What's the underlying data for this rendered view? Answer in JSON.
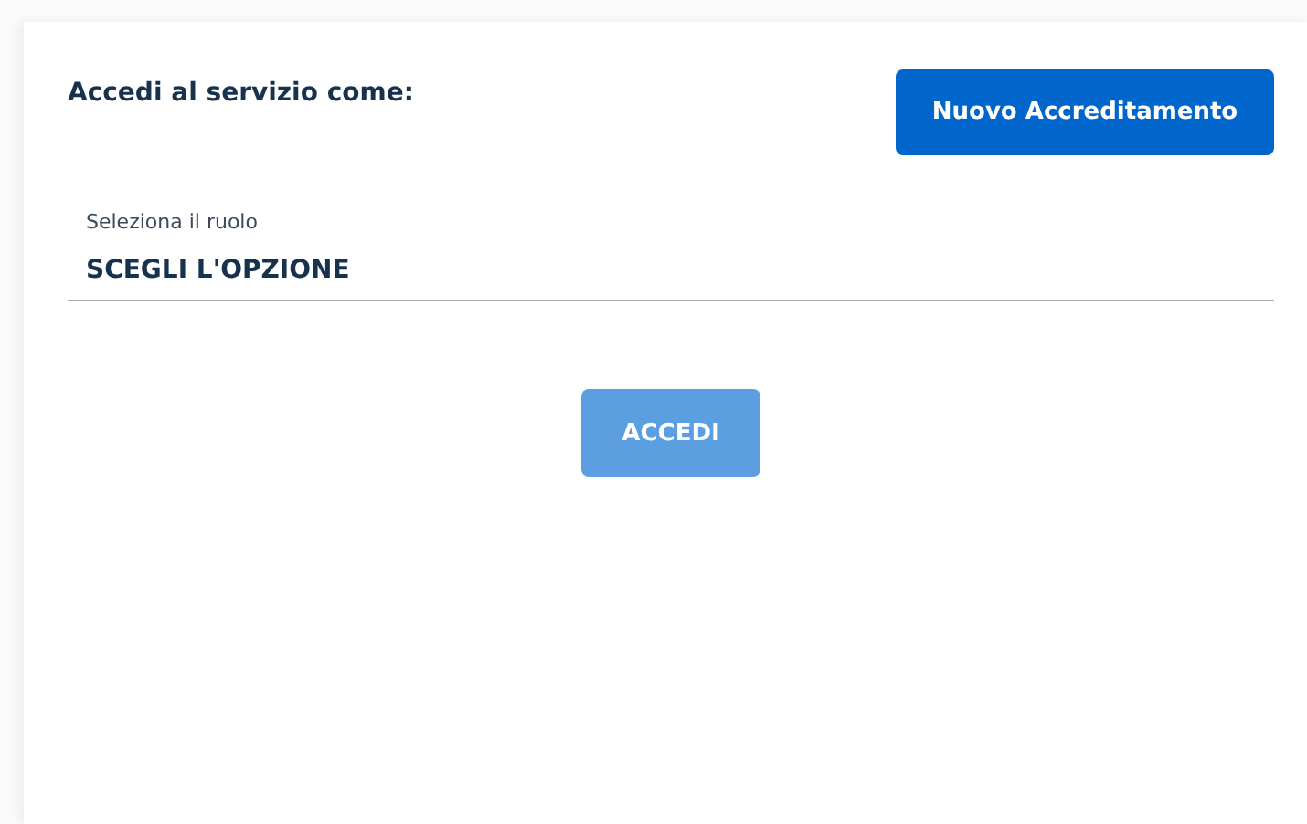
{
  "heading": "Accedi al servizio come:",
  "new_button": {
    "label": "Nuovo Accreditamento"
  },
  "role_select": {
    "label": "Seleziona il ruolo",
    "value": "SCEGLI L'OPZIONE"
  },
  "submit_button": {
    "label": "ACCEDI",
    "disabled": true
  }
}
